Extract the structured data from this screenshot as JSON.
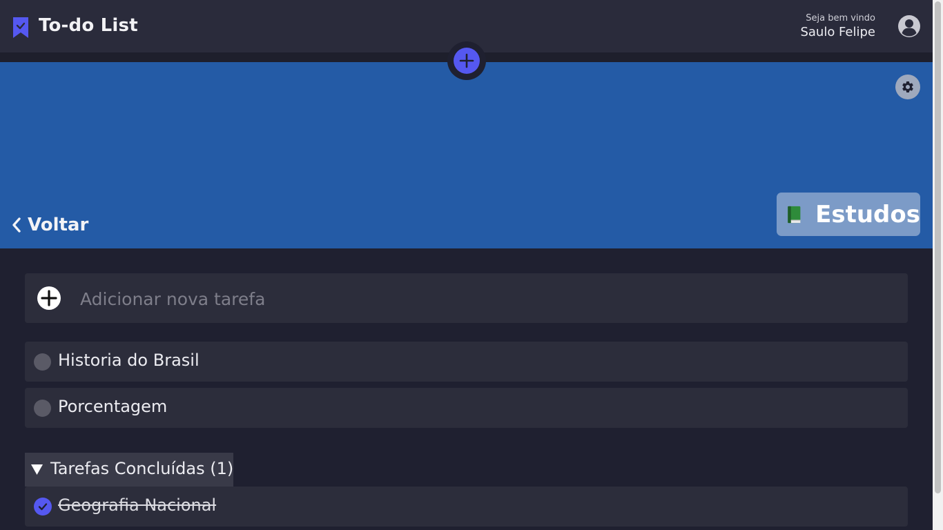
{
  "header": {
    "app_title": "To-do List",
    "welcome_text": "Seja bem vindo",
    "user_name": "Saulo Felipe",
    "logo_icon": "bookmark-check-icon",
    "avatar_icon": "user-circle-icon"
  },
  "fab": {
    "icon": "plus-icon"
  },
  "banner": {
    "background_color": "#245ba6",
    "back_label": "Voltar",
    "list_name": "Estudos",
    "list_emoji": "green-book-icon",
    "settings_icon": "gear-icon"
  },
  "add_task": {
    "placeholder": "Adicionar nova tarefa",
    "value": ""
  },
  "tasks": [
    {
      "label": "Historia do Brasil",
      "completed": false
    },
    {
      "label": "Porcentagem",
      "completed": false
    }
  ],
  "completed_section": {
    "label": "Tarefas Concluídas (1)",
    "expanded": true,
    "tasks": [
      {
        "label": "Geografia Nacional",
        "completed": true
      }
    ]
  },
  "colors": {
    "accent": "#5558f0",
    "header_bg": "#2a2b3b",
    "page_bg": "#1f2030",
    "card_bg": "#2c2d3b"
  }
}
